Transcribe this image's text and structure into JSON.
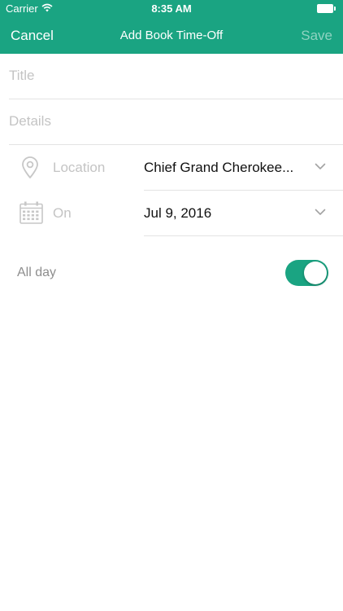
{
  "status_bar": {
    "carrier": "Carrier",
    "time": "8:35 AM",
    "icons": [
      "wifi-icon",
      "battery-icon"
    ]
  },
  "nav": {
    "cancel_label": "Cancel",
    "title": "Add Book Time-Off",
    "save_label": "Save"
  },
  "form": {
    "title_placeholder": "Title",
    "details_placeholder": "Details",
    "location": {
      "label": "Location",
      "value": "Chief Grand Cherokee...",
      "icon": "location-pin-icon"
    },
    "on": {
      "label": "On",
      "value": "Jul 9, 2016",
      "icon": "calendar-icon"
    },
    "all_day": {
      "label": "All day",
      "on": true
    }
  },
  "colors": {
    "accent": "#1aa482",
    "save_disabled": "#8fd3c1",
    "placeholder": "#c4c4c4"
  }
}
